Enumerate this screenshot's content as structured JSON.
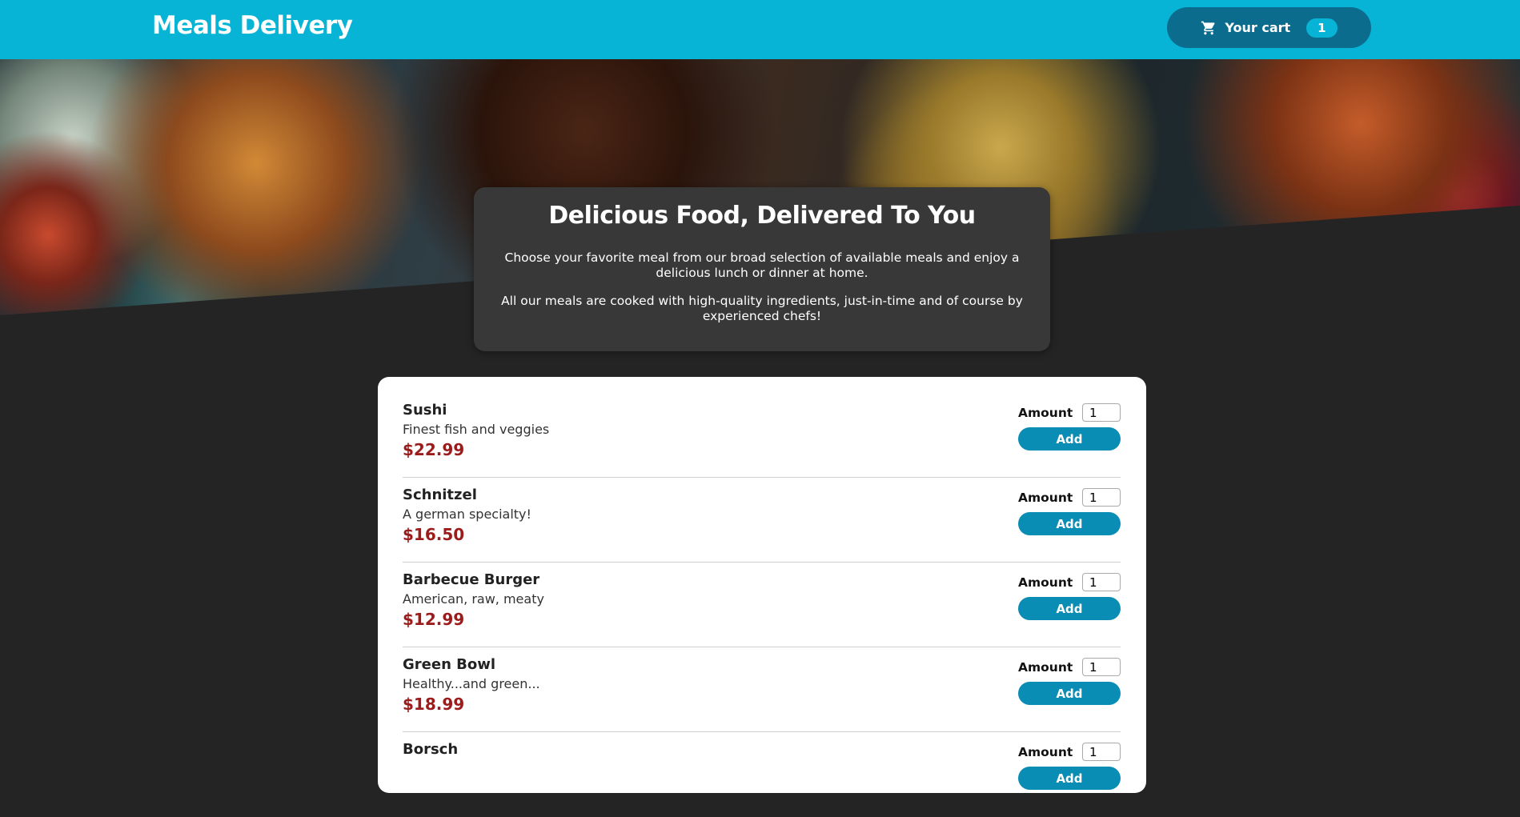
{
  "header": {
    "title": "Meals Delivery",
    "cart_label": "Your cart",
    "cart_count": "1"
  },
  "summary": {
    "heading": "Delicious Food, Delivered To You",
    "paragraph_1": "Choose your favorite meal from our broad selection of available meals and enjoy a delicious lunch or dinner at home.",
    "paragraph_2": "All our meals are cooked with high-quality ingredients, just-in-time and of course by experienced chefs!"
  },
  "meal_form": {
    "amount_label": "Amount",
    "add_label": "Add"
  },
  "meals": [
    {
      "name": "Sushi",
      "description": "Finest fish and veggies",
      "price": "$22.99",
      "amount": "1"
    },
    {
      "name": "Schnitzel",
      "description": "A german specialty!",
      "price": "$16.50",
      "amount": "1"
    },
    {
      "name": "Barbecue Burger",
      "description": "American, raw, meaty",
      "price": "$12.99",
      "amount": "1"
    },
    {
      "name": "Green Bowl",
      "description": "Healthy...and green...",
      "price": "$18.99",
      "amount": "1"
    },
    {
      "name": "Borsch",
      "description": "",
      "price": "",
      "amount": "1"
    }
  ],
  "colors": {
    "header_bg": "#07b4d6",
    "cart_button_bg": "#0b6c8e",
    "price": "#9c1b1b",
    "add_button": "#0a8db5",
    "page_bg": "#242424"
  },
  "icons": {
    "cart": "shopping-cart-icon"
  }
}
